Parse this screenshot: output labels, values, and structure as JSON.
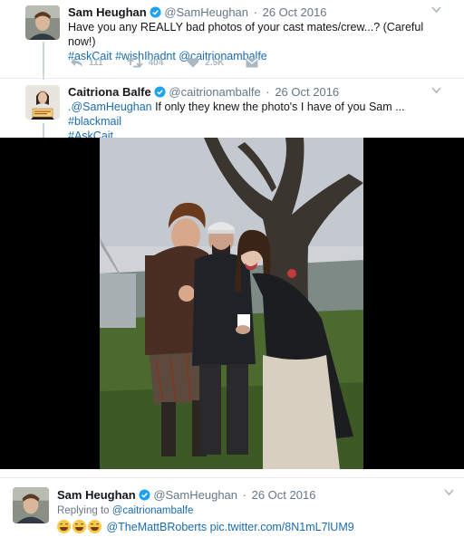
{
  "tweet1": {
    "name": "Sam Heughan",
    "handle": "@SamHeughan",
    "separator": "·",
    "date": "26 Oct 2016",
    "text": "Have you any REALLY bad photos of your cast mates/crew...? (Careful now!)",
    "hashtags": "#askCait #wishIhadnt @caitrionambalfe",
    "reply_count": "111",
    "retweet_count": "404",
    "like_count": "2.5K",
    "icons": [
      "verified-icon",
      "reply-icon",
      "retweet-icon",
      "like-icon",
      "message-icon",
      "chevron-down-icon"
    ]
  },
  "tweet2": {
    "name": "Caitriona Balfe",
    "handle": "@caitrionambalfe",
    "separator": "·",
    "date": "26 Oct 2016",
    "mention": ".@SamHeughan",
    "text": " If only they knew the photo's I have of you Sam ... ",
    "hashtag_inline": "#blackmail",
    "hashtag_line2": "#AskCait"
  },
  "tweet3": {
    "name": "Sam Heughan",
    "handle": "@SamHeughan",
    "separator": "·",
    "date": "26 Oct 2016",
    "replying_prefix": "Replying to ",
    "replying_to": "@caitrionambalfe",
    "mention": "@TheMattBRoberts",
    "link": "pic.twitter.com/8N1mL7lUM9"
  },
  "colors": {
    "accent": "#1b6bb0",
    "verified": "#1da1f2",
    "muted": "#657786",
    "icon_muted": "#aab8c2"
  }
}
